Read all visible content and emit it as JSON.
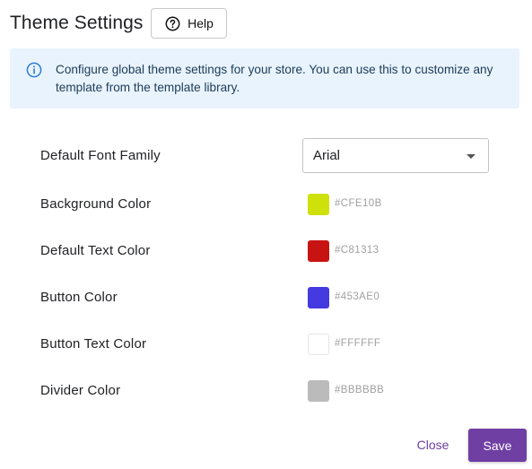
{
  "header": {
    "title": "Theme Settings",
    "help_label": "Help"
  },
  "info": {
    "text": "Configure global theme settings for your store. You can use this to customize any template from the template library."
  },
  "settings": {
    "font_family": {
      "label": "Default Font Family",
      "value": "Arial"
    },
    "background_color": {
      "label": "Background Color",
      "hex": "#CFE10B",
      "color": "#CFE10B"
    },
    "text_color": {
      "label": "Default Text Color",
      "hex": "#C81313",
      "color": "#C81313"
    },
    "button_color": {
      "label": "Button Color",
      "hex": "#453AE0",
      "color": "#453AE0"
    },
    "button_text_color": {
      "label": "Button Text Color",
      "hex": "#FFFFFF",
      "color": "#FFFFFF"
    },
    "divider_color": {
      "label": "Divider Color",
      "hex": "#BBBBBB",
      "color": "#BBBBBB"
    }
  },
  "footer": {
    "close_label": "Close",
    "save_label": "Save"
  },
  "colors": {
    "accent": "#6F3FA3",
    "info_background": "#E8F3FD",
    "info_icon": "#2B7BD6"
  },
  "icons": {
    "help": "question-circle-icon",
    "info": "info-circle-icon",
    "select_caret": "caret-down-icon"
  }
}
